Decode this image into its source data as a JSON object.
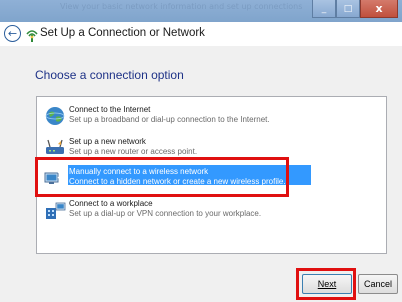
{
  "window": {
    "title": "Set Up a Connection or Network",
    "ghost_text": "View your basic network information and set up connections"
  },
  "window_controls": {
    "minimize": "_",
    "maximize": "□",
    "close": "x"
  },
  "section_title": "Choose a connection option",
  "options": [
    {
      "title": "Connect to the Internet",
      "desc": "Set up a broadband or dial-up connection to the Internet.",
      "icon": "globe-icon",
      "selected": false
    },
    {
      "title": "Set up a new network",
      "desc": "Set up a new router or access point.",
      "icon": "router-icon",
      "selected": false
    },
    {
      "title": "Manually connect to a wireless network",
      "desc": "Connect to a hidden network or create a new wireless profile.",
      "icon": "wireless-network-icon",
      "selected": true
    },
    {
      "title": "Connect to a workplace",
      "desc": "Set up a dial-up or VPN connection to your workplace.",
      "icon": "workplace-icon",
      "selected": false
    }
  ],
  "buttons": {
    "next": "Next",
    "cancel": "Cancel"
  },
  "colors": {
    "selection": "#3399ff",
    "highlight_box": "#e01010",
    "section_title": "#1e3287"
  }
}
